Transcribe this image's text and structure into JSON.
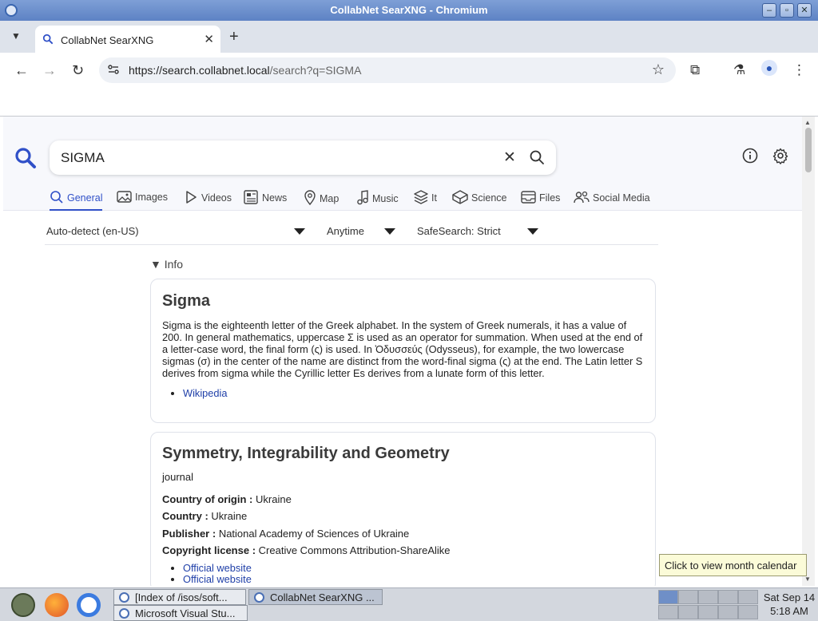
{
  "window": {
    "title": "CollabNet SearXNG - Chromium"
  },
  "browser": {
    "tab_title": "CollabNet SearXNG",
    "url_host": "https://search.collabnet.local",
    "url_path": "/search?q=SIGMA"
  },
  "search": {
    "query": "SIGMA"
  },
  "categories": [
    "General",
    "Images",
    "Videos",
    "News",
    "Map",
    "Music",
    "It",
    "Science",
    "Files",
    "Social Media"
  ],
  "filters": {
    "language": "Auto-detect (en-US)",
    "time": "Anytime",
    "safesearch": "SafeSearch: Strict"
  },
  "info_label": "▼ Info",
  "cards": [
    {
      "title": "Sigma",
      "description": "Sigma is the eighteenth letter of the Greek alphabet. In the system of Greek numerals, it has a value of 200. In general mathematics, uppercase Σ is used as an operator for summation. When used at the end of a letter-case word, the final form (ς) is used. In Ὀδυσσεύς (Odysseus), for example, the two lowercase sigmas (σ) in the center of the name are distinct from the word-final sigma (ς) at the end. The Latin letter S derives from sigma while the Cyrillic letter Es derives from a lunate form of this letter.",
      "links": [
        "Wikipedia"
      ]
    },
    {
      "title": "Symmetry, Integrability and Geometry",
      "subtitle": "journal",
      "attributes": [
        {
          "label": "Country of origin :",
          "value": "Ukraine"
        },
        {
          "label": "Country :",
          "value": "Ukraine"
        },
        {
          "label": "Publisher :",
          "value": "National Academy of Sciences of Ukraine"
        },
        {
          "label": "Copyright license :",
          "value": "Creative Commons Attribution-ShareAlike"
        }
      ],
      "links": [
        "Official website",
        "Official website"
      ]
    }
  ],
  "tooltip": "Click to view month calendar",
  "taskbar": {
    "tasks": [
      "[Index of /isos/soft...",
      "CollabNet SearXNG ...",
      "Microsoft Visual Stu..."
    ],
    "clock_date": "Sat Sep 14",
    "clock_time": "5:18 AM"
  },
  "colors": {
    "accent": "#3050c8",
    "link": "#1f3fa8",
    "titlebar": "#6a8ccd"
  }
}
